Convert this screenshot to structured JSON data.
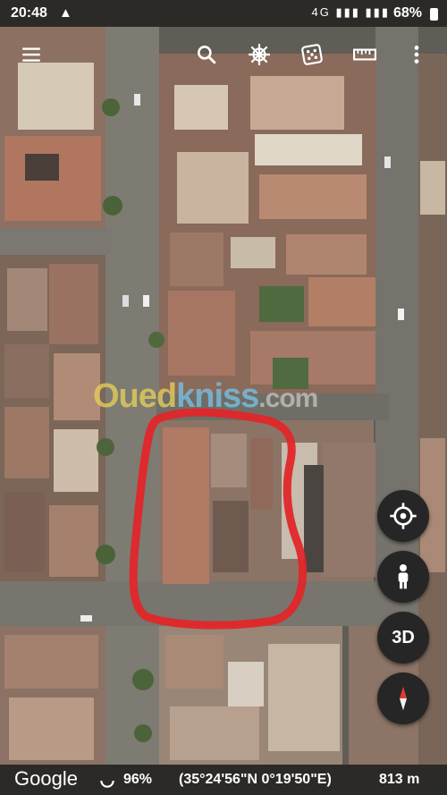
{
  "status_bar": {
    "time": "20:48",
    "signal_text": "4G ▮▮▮ ▮▮▮",
    "battery": "68%"
  },
  "toolbar": {
    "menu": "menu-icon",
    "search": "search-icon",
    "voyager": "ship-wheel-icon",
    "feeling_lucky": "dice-icon",
    "measure": "ruler-icon",
    "more": "more-vert-icon"
  },
  "map": {
    "watermark": {
      "part1": "Oued",
      "part2": "kniss",
      "part3": ".com"
    }
  },
  "controls": {
    "location": "my-location-icon",
    "street_view": "pegman-icon",
    "three_d": "3D",
    "compass": "compass-icon"
  },
  "bottom_bar": {
    "logo": "Google",
    "loading": "96%",
    "coordinates": "(35°24'56\"N 0°19'50\"E)",
    "altitude": "813 m"
  }
}
